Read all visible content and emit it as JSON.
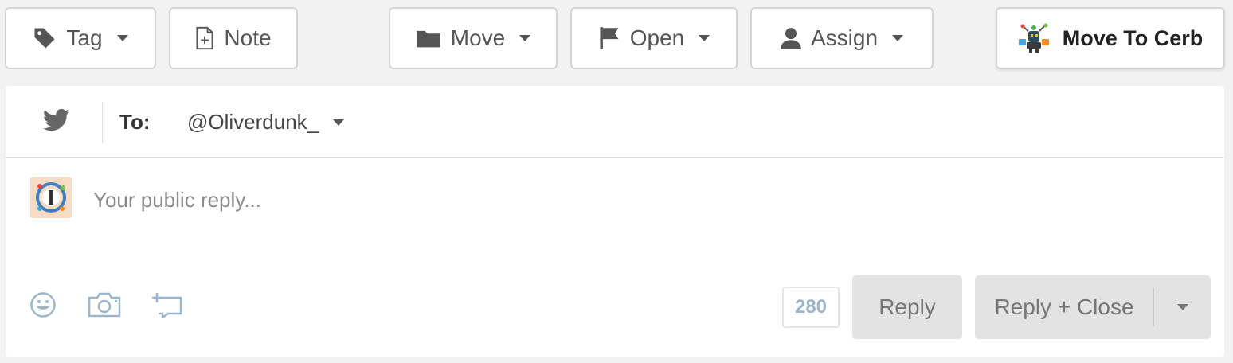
{
  "toolbar": {
    "tag_label": "Tag",
    "note_label": "Note",
    "move_label": "Move",
    "open_label": "Open",
    "assign_label": "Assign",
    "move_to_cerb_label": "Move To Cerb"
  },
  "compose": {
    "channel_icon": "twitter-icon",
    "to_label": "To:",
    "to_value": "@Oliverdunk_",
    "reply_placeholder": "Your public reply...",
    "char_count": "280",
    "reply_label": "Reply",
    "reply_close_label": "Reply + Close"
  },
  "colors": {
    "twitter_icon": "#666666",
    "count_text": "#9bb6c9",
    "tool_icon": "#9bb6c9",
    "button_disabled_bg": "#e3e3e3"
  }
}
